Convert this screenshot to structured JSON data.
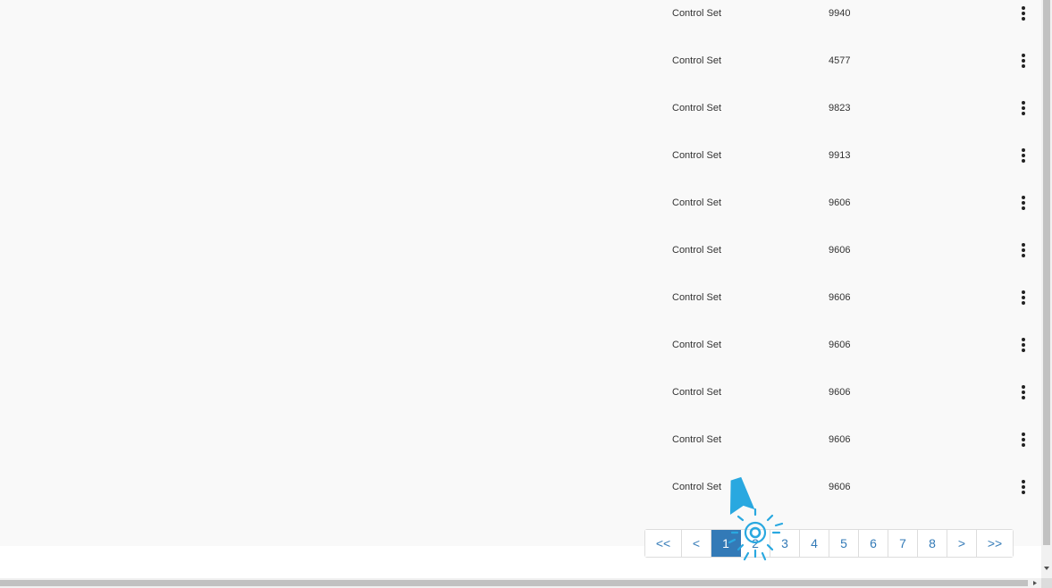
{
  "table": {
    "rows": [
      {
        "type": "Control Set",
        "id": "9940"
      },
      {
        "type": "Control Set",
        "id": "4577"
      },
      {
        "type": "Control Set",
        "id": "9823"
      },
      {
        "type": "Control Set",
        "id": "9913"
      },
      {
        "type": "Control Set",
        "id": "9606"
      },
      {
        "type": "Control Set",
        "id": "9606"
      },
      {
        "type": "Control Set",
        "id": "9606"
      },
      {
        "type": "Control Set",
        "id": "9606"
      },
      {
        "type": "Control Set",
        "id": "9606"
      },
      {
        "type": "Control Set",
        "id": "9606"
      },
      {
        "type": "Control Set",
        "id": "9606"
      }
    ],
    "row_menu_icon": "more-vertical-icon"
  },
  "pagination": {
    "first": "<<",
    "prev": "<",
    "pages": [
      "1",
      "2",
      "3",
      "4",
      "5",
      "6",
      "7",
      "8"
    ],
    "active_page": "1",
    "next": ">",
    "last": ">>"
  },
  "click_indicator": {
    "icon": "click-cursor-icon",
    "color": "#29a8e0"
  },
  "colors": {
    "accent": "#337ab7",
    "background": "#f9f9f9"
  }
}
